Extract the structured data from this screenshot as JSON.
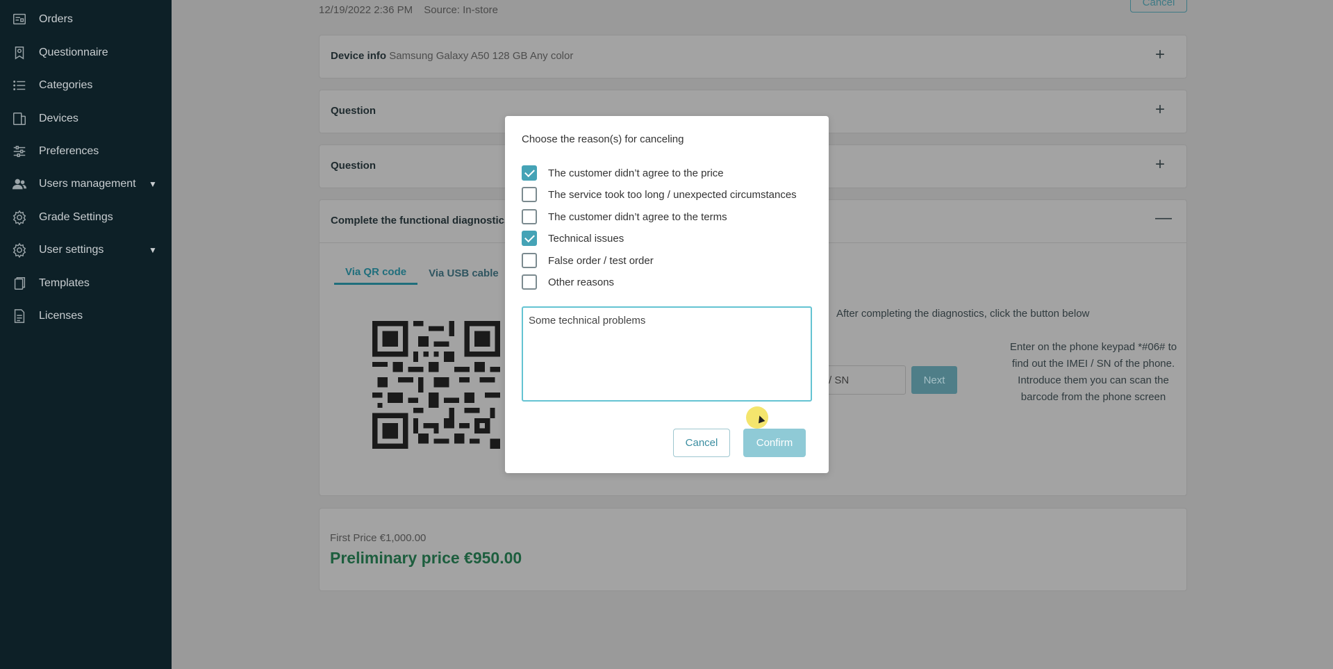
{
  "sidebar": {
    "items": [
      {
        "label": "Orders",
        "icon": "orders-icon"
      },
      {
        "label": "Questionnaire",
        "icon": "questionnaire-icon"
      },
      {
        "label": "Categories",
        "icon": "list-icon"
      },
      {
        "label": "Devices",
        "icon": "devices-icon"
      },
      {
        "label": "Preferences",
        "icon": "sliders-icon"
      },
      {
        "label": "Users management",
        "icon": "users-icon",
        "caret": "▼"
      },
      {
        "label": "Grade Settings",
        "icon": "gear-icon"
      },
      {
        "label": "User settings",
        "icon": "gear-icon",
        "caret": "▼"
      },
      {
        "label": "Templates",
        "icon": "templates-icon"
      },
      {
        "label": "Licenses",
        "icon": "document-icon"
      }
    ]
  },
  "order": {
    "datetime": "12/19/2022 2:36 PM",
    "source": "Source: In-store",
    "cancel_label": "Cancel"
  },
  "cards": {
    "device_info_label": "Device info",
    "device_info_value": "Samsung Galaxy A50 128 GB Any color",
    "question1": "Question",
    "question2": "Question",
    "diagnostics_title": "Complete the functional diagnostics",
    "expand_symbol": "+",
    "collapse_symbol": "—"
  },
  "diagnostics": {
    "tabs": [
      "Via QR code",
      "Via USB cable"
    ],
    "after_note": "After completing the diagnostics, click the button below",
    "imei_placeholder": "/ SN",
    "next_label": "Next",
    "imei_help": "Enter on the phone keypad *#06# to find out the IMEI / SN of the phone. Introduce them you can scan the barcode from the phone screen"
  },
  "prices": {
    "first_price": "First Price €1,000.00",
    "preliminary_price": "Preliminary price €950.00"
  },
  "modal": {
    "title": "Choose the reason(s) for canceling",
    "reasons": [
      {
        "label": "The customer didn’t agree to the price",
        "checked": true
      },
      {
        "label": "The service took too long / unexpected circumstances",
        "checked": false
      },
      {
        "label": "The customer didn’t agree to the terms",
        "checked": false
      },
      {
        "label": "Technical issues",
        "checked": true
      },
      {
        "label": "False order / test order",
        "checked": false
      },
      {
        "label": "Other reasons",
        "checked": false
      }
    ],
    "comment": "Some technical problems",
    "cancel_label": "Cancel",
    "confirm_label": "Confirm"
  },
  "colors": {
    "sidebar_bg": "#0d2027",
    "accent": "#45a3b6",
    "price_green": "#1d5e3e"
  }
}
